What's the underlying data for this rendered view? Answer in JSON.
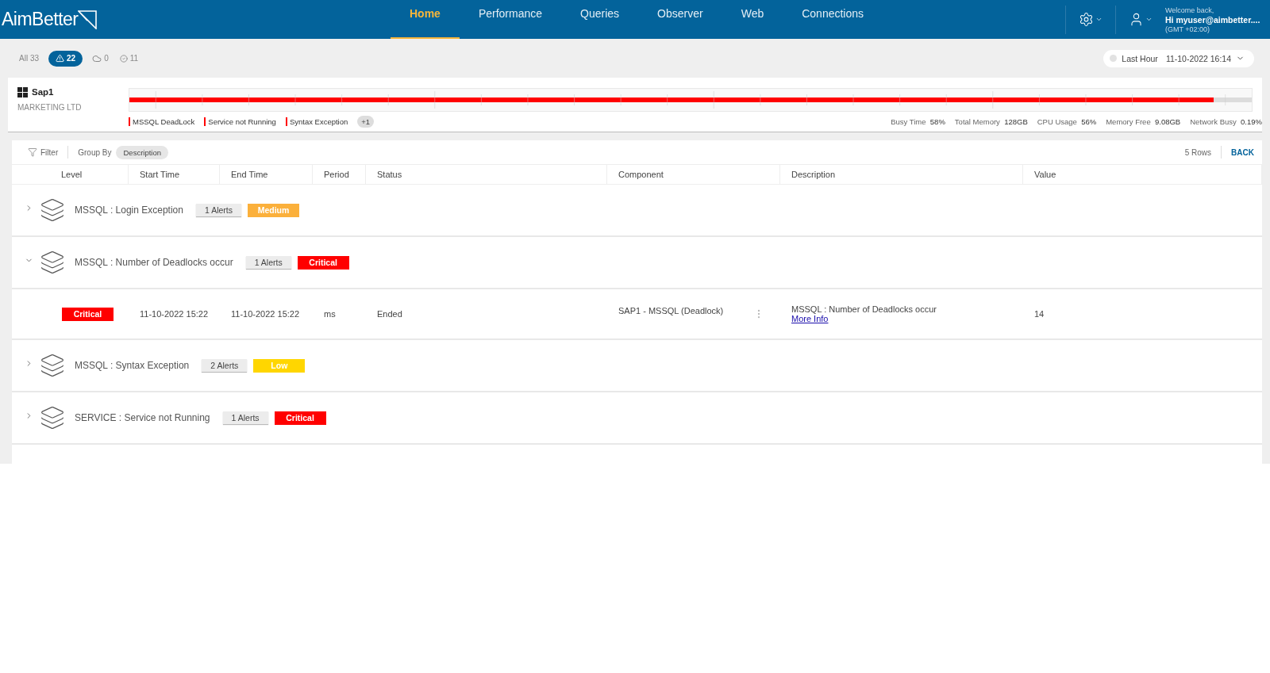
{
  "header": {
    "logo": "AimBetter",
    "nav": [
      {
        "label": "Home",
        "selected": true
      },
      {
        "label": "Performance",
        "selected": false
      },
      {
        "label": "Queries",
        "selected": false
      },
      {
        "label": "Observer",
        "selected": false
      },
      {
        "label": "Web",
        "selected": false
      },
      {
        "label": "Connections",
        "selected": false
      }
    ],
    "user": {
      "greeting": "Welcome back,",
      "name": "Hi myuser@aimbetter....",
      "timezone": "(GMT +02:00)"
    }
  },
  "filters": [
    {
      "kind": "all",
      "label": "All 33",
      "selected": false
    },
    {
      "kind": "alert",
      "label": "22",
      "selected": true
    },
    {
      "kind": "cloud",
      "label": "0",
      "selected": false
    },
    {
      "kind": "check",
      "label": "11",
      "selected": false
    }
  ],
  "time_range": {
    "label": "Last Hour",
    "value": "11-10-2022 16:14"
  },
  "server": {
    "name": "Sap1",
    "company": "MARKETING LTD",
    "timeline": {
      "level": 0.966
    },
    "legend": [
      {
        "label": "MSSQL DeadLock",
        "color": "#ff0000"
      },
      {
        "label": "Service not Running",
        "color": "#ff0000"
      },
      {
        "label": "Syntax Exception",
        "color": "#ff0000"
      }
    ],
    "more": "+1",
    "stats": [
      {
        "label": "Busy Time",
        "value": "58%"
      },
      {
        "label": "Total Memory",
        "value": "128GB"
      },
      {
        "label": "CPU Usage",
        "value": "56%"
      },
      {
        "label": "Memory Free",
        "value": "9.08GB"
      },
      {
        "label": "Network Busy",
        "value": "0.19%"
      }
    ]
  },
  "toolbar": {
    "filter": "Filter",
    "group_by_label": "Group By",
    "group_by": "Description",
    "rows": "5 Rows",
    "back": "BACK"
  },
  "table": {
    "columns": [
      "Level",
      "Start Time",
      "End Time",
      "Period",
      "Status",
      "Component",
      "Description",
      "Value"
    ],
    "groups": [
      {
        "title": "MSSQL : Login Exception",
        "alerts": "1 Alerts",
        "severity": "Medium",
        "color": "#fbb03b",
        "expanded": false
      },
      {
        "title": "MSSQL : Number of Deadlocks occur",
        "alerts": "1 Alerts",
        "severity": "Critical",
        "color": "#ff0000",
        "expanded": true,
        "children": [
          {
            "severity": "Critical",
            "color": "#ff0000",
            "start": "11-10-2022 15:22",
            "end": "11-10-2022 15:22",
            "period": "ms",
            "status": "Ended",
            "component": "SAP1 - MSSQL (Deadlock)",
            "description": "MSSQL : Number of Deadlocks occur",
            "link": "More Info",
            "value": "14"
          }
        ]
      },
      {
        "title": "MSSQL : Syntax Exception",
        "alerts": "2 Alerts",
        "severity": "Low",
        "color": "#ffd600",
        "expanded": false
      },
      {
        "title": "SERVICE : Service not Running",
        "alerts": "1 Alerts",
        "severity": "Critical",
        "color": "#ff0000",
        "expanded": false
      }
    ]
  }
}
